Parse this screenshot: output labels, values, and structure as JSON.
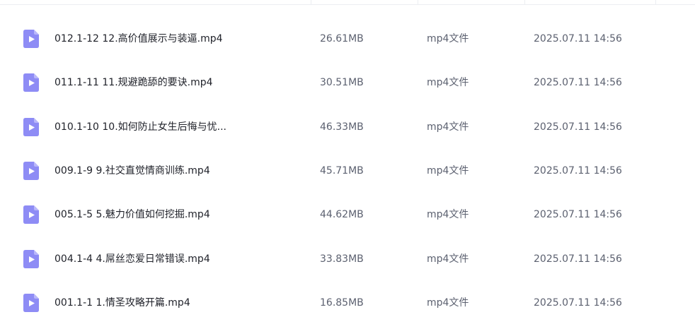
{
  "files": [
    {
      "name": "012.1-12 12.高价值展示与装逼.mp4",
      "size": "26.61MB",
      "type": "mp4文件",
      "date": "2025.07.11 14:56"
    },
    {
      "name": "011.1-11 11.规避跪舔的要诀.mp4",
      "size": "30.51MB",
      "type": "mp4文件",
      "date": "2025.07.11 14:56"
    },
    {
      "name": "010.1-10 10.如何防止女生后悔与忧...",
      "size": "46.33MB",
      "type": "mp4文件",
      "date": "2025.07.11 14:56"
    },
    {
      "name": "009.1-9 9.社交直觉情商训练.mp4",
      "size": "45.71MB",
      "type": "mp4文件",
      "date": "2025.07.11 14:56"
    },
    {
      "name": "005.1-5 5.魅力价值如何挖掘.mp4",
      "size": "44.62MB",
      "type": "mp4文件",
      "date": "2025.07.11 14:56"
    },
    {
      "name": "004.1-4 4.屌丝恋爱日常错误.mp4",
      "size": "33.83MB",
      "type": "mp4文件",
      "date": "2025.07.11 14:56"
    },
    {
      "name": "001.1-1 1.情圣攻略开篇.mp4",
      "size": "16.85MB",
      "type": "mp4文件",
      "date": "2025.07.11 14:56"
    }
  ],
  "icon": "video-file-icon",
  "colors": {
    "icon": "#8e8cf5",
    "icon_play": "#ffffff",
    "name_text": "#1f2129",
    "meta_text": "#5c6170"
  }
}
